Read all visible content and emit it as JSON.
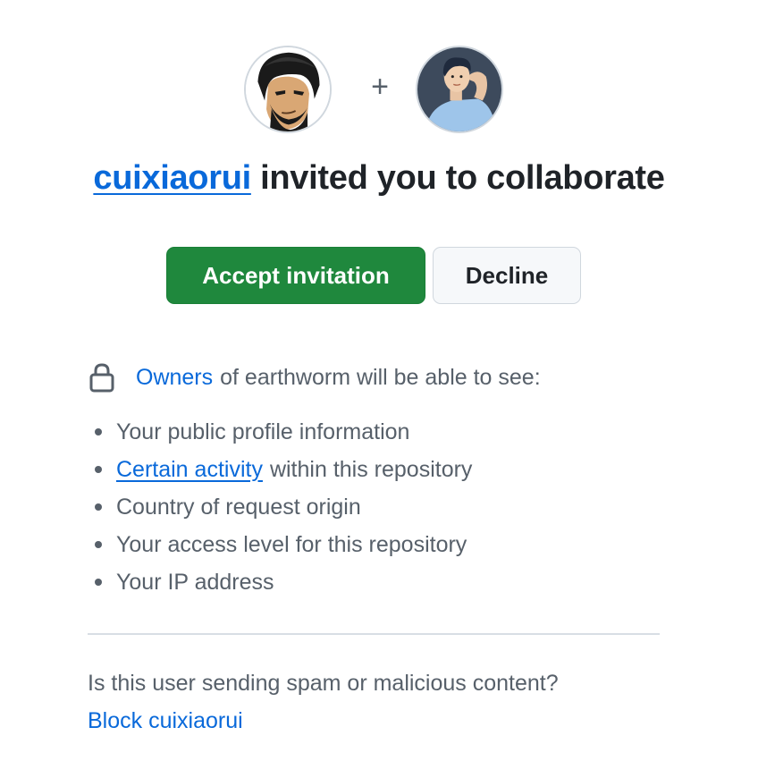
{
  "invitation": {
    "inviter": "cuixiaorui",
    "headline_rest": "invited you to collaborate",
    "plus_symbol": "+"
  },
  "actions": {
    "accept_label": "Accept invitation",
    "decline_label": "Decline"
  },
  "visibility": {
    "owners_link": "Owners",
    "statement": "of earthworm will be able to see:",
    "items": [
      {
        "link": "",
        "text": "Your public profile information"
      },
      {
        "link": "Certain activity",
        "text": "within this repository"
      },
      {
        "link": "",
        "text": "Country of request origin"
      },
      {
        "link": "",
        "text": "Your access level for this repository"
      },
      {
        "link": "",
        "text": "Your IP address"
      }
    ]
  },
  "report": {
    "question": "Is this user sending spam or malicious content?",
    "block_link": "Block cuixiaorui"
  },
  "colors": {
    "accent": "#0969da",
    "accept_green": "#1f883d",
    "muted_text": "#57606a"
  },
  "icons": [
    "inviter-avatar",
    "invitee-avatar",
    "lock-icon",
    "bullet"
  ]
}
